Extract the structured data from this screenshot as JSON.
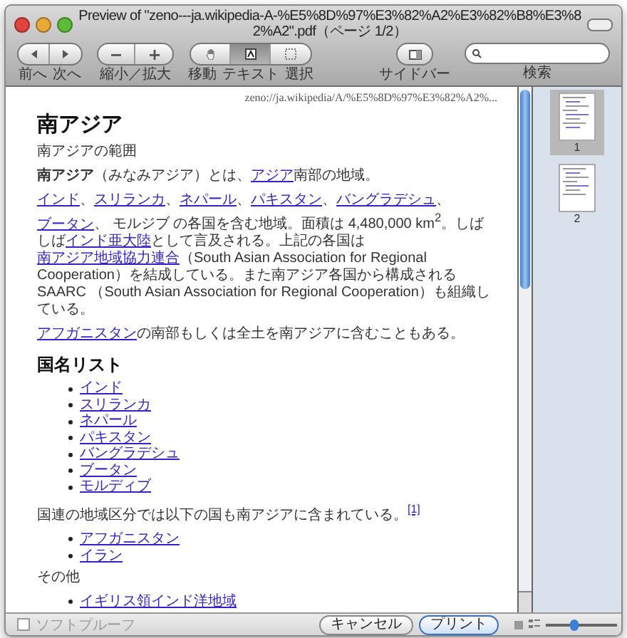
{
  "window": {
    "title": "Preview of \"zeno---ja.wikipedia-A-%E5%8D%97%E3%82%A2%E3%82%B8%E3%82%A2\".pdf（ページ 1/2）"
  },
  "toolbar": {
    "nav": [
      {
        "kind": "prev",
        "label": "前へ"
      },
      {
        "kind": "next",
        "label": "次へ"
      }
    ],
    "zoom": {
      "label": "縮小／拡大"
    },
    "tools": [
      {
        "kind": "move",
        "label": "移動",
        "selected": false
      },
      {
        "kind": "text",
        "label": "テキスト",
        "selected": true
      },
      {
        "kind": "select",
        "label": "選択",
        "selected": false
      }
    ],
    "sidebar_button": {
      "label": "サイドバー"
    },
    "search": {
      "label": "検索"
    }
  },
  "document": {
    "url": "zeno://ja.wikipedia/A/%E5%8D%97%E3%82%A2%...",
    "blocks": [
      {
        "kind": "h1",
        "text": "南アジア"
      },
      {
        "kind": "p",
        "segments": [
          {
            "kind": "text",
            "text": "南アジアの範囲"
          }
        ]
      },
      {
        "kind": "p",
        "segments": [
          {
            "kind": "bold",
            "text": "南アジア"
          },
          {
            "kind": "text",
            "text": "（みなみアジア）とは、"
          },
          {
            "kind": "link",
            "text": "アジア"
          },
          {
            "kind": "text",
            "text": "南部の地域。"
          }
        ]
      },
      {
        "kind": "p",
        "segments": [
          {
            "kind": "link",
            "text": "インド"
          },
          {
            "kind": "text",
            "text": "、"
          },
          {
            "kind": "link",
            "text": "スリランカ"
          },
          {
            "kind": "text",
            "text": "、"
          },
          {
            "kind": "link",
            "text": "ネパール"
          },
          {
            "kind": "text",
            "text": "、"
          },
          {
            "kind": "link",
            "text": "パキスタン"
          },
          {
            "kind": "text",
            "text": "、"
          },
          {
            "kind": "link",
            "text": "バングラデシュ"
          },
          {
            "kind": "text",
            "text": "、"
          },
          {
            "kind": "link",
            "text": "ブータン"
          },
          {
            "kind": "text",
            "text": "、 モルジブ の各国を含む地域。面積は 4,480,000 km$^{2}$。しばしば"
          },
          {
            "kind": "link",
            "text": "インド亜大陸"
          },
          {
            "kind": "text",
            "text": "として言及される。上記の各国は"
          },
          {
            "kind": "link",
            "text": "南アジア地域協力連合"
          },
          {
            "kind": "text",
            "text": "（South Asian Association for Regional Cooperation）を結成している。また南アジア各国から構成される SAARC （South Asian Association for Regional Cooperation）も組織している。"
          }
        ]
      },
      {
        "kind": "p",
        "segments": [
          {
            "kind": "link",
            "text": "アフガニスタン"
          },
          {
            "kind": "text",
            "text": "の南部もしくは全土を南アジアに含むこともある。"
          }
        ]
      },
      {
        "kind": "h2",
        "text": "国名リスト"
      },
      {
        "kind": "list",
        "items": [
          "インド",
          "スリランカ",
          "ネパール",
          "パキスタン",
          "バングラデシュ",
          "ブータン",
          "モルディブ"
        ]
      },
      {
        "kind": "p",
        "segments": [
          {
            "kind": "text",
            "text": "国連の地域区分では以下の国も南アジアに含まれている。"
          },
          {
            "kind": "ref",
            "text": "[1]"
          }
        ]
      },
      {
        "kind": "list",
        "items": [
          "アフガニスタン",
          "イラン"
        ]
      },
      {
        "kind": "p",
        "segments": [
          {
            "kind": "text",
            "text": "その他"
          }
        ]
      },
      {
        "kind": "list",
        "items": [
          "イギリス領インド洋地域"
        ]
      }
    ]
  },
  "sidebar": {
    "pages": [
      {
        "label": "1",
        "selected": true
      },
      {
        "label": "2",
        "selected": false
      }
    ]
  },
  "bottom": {
    "softproof": {
      "label": "ソフトプルーフ",
      "checked": false
    },
    "buttons": [
      {
        "kind": "cancel",
        "label": "キャンセル"
      },
      {
        "kind": "default",
        "label": "プリント"
      }
    ],
    "thumbnail_slider": {
      "level": 0.4
    }
  }
}
